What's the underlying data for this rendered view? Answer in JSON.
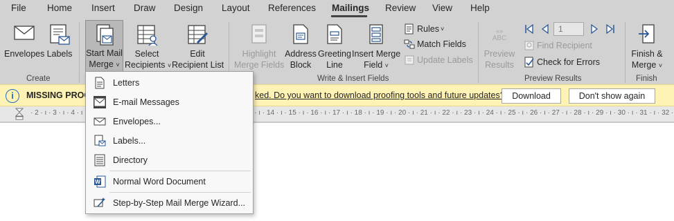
{
  "tabs": [
    "File",
    "Home",
    "Insert",
    "Draw",
    "Design",
    "Layout",
    "References",
    "Mailings",
    "Review",
    "View",
    "Help"
  ],
  "active_tab": "Mailings",
  "ribbon": {
    "groups": {
      "create": "Create",
      "write_insert": "Write & Insert Fields",
      "preview_results": "Preview Results",
      "finish": "Finish"
    },
    "buttons": {
      "envelopes": "Envelopes",
      "labels": "Labels",
      "start_mail_merge_1": "Start Mail",
      "start_mail_merge_2": "Merge",
      "select_recipients_1": "Select",
      "select_recipients_2": "Recipients",
      "edit_recipient_list_1": "Edit",
      "edit_recipient_list_2": "Recipient List",
      "highlight_merge_fields_1": "Highlight",
      "highlight_merge_fields_2": "Merge Fields",
      "address_block_1": "Address",
      "address_block_2": "Block",
      "greeting_line_1": "Greeting",
      "greeting_line_2": "Line",
      "insert_merge_field_1": "Insert Merge",
      "insert_merge_field_2": "Field",
      "rules": "Rules",
      "match_fields": "Match Fields",
      "update_labels": "Update Labels",
      "preview_results_1": "Preview",
      "preview_results_2": "Results",
      "preview_abc": "ABC",
      "find_recipient": "Find Recipient",
      "check_for_errors": "Check for Errors",
      "finish_merge_1": "Finish &",
      "finish_merge_2": "Merge",
      "record_number": "1"
    }
  },
  "message_bar": {
    "title": "MISSING PROO",
    "text": "ked. Do you want to download proofing tools and future updates?",
    "download": "Download",
    "dont_show": "Don't show again"
  },
  "ruler": {
    "text": "· 2 · ı · 3 · ı · 4 · ı · 5 · ı · 6 · ı · 7 · ı · 8 · ı · 9 · ı · 10 · ı · 11 · ı · 12 · ı · 13 · ı · 14 · ı · 15 · ı · 16 · ı · 17 · ı · 18 · ı · 19 · ı · 20 · ı · 21 · ı · 22 · ı · 23 · ı · 24 · ı · 25 · ı · 26 · ı · 27 · ı · 28 · ı · 29 · ı · 30 · ı · 31 · ı · 32 ·"
  },
  "menu": {
    "items": [
      "Letters",
      "E-mail Messages",
      "Envelopes...",
      "Labels...",
      "Directory",
      "Normal Word Document",
      "Step-by-Step Mail Merge Wizard..."
    ]
  },
  "colors": {
    "ribbon_bg": "#d2d2d2",
    "message_bar_bg": "#fff2b5",
    "info_blue": "#1e6fbf",
    "accent_blue": "#2b5797",
    "disabled_text": "#9a9a9a"
  }
}
